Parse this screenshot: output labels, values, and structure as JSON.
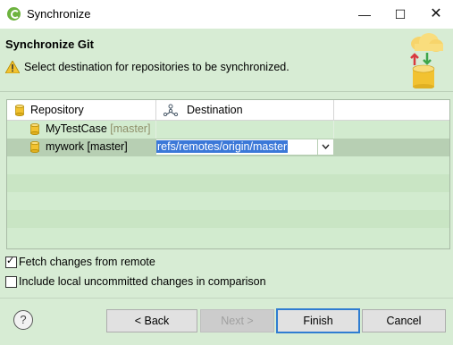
{
  "window": {
    "title": "Synchronize",
    "minimize": "—",
    "maximize": "☐",
    "close": "✕"
  },
  "header": {
    "title": "Synchronize Git",
    "message": "Select destination for repositories to be synchronized."
  },
  "table": {
    "columns": [
      "Repository",
      "Destination"
    ],
    "rows": [
      {
        "name": "MyTestCase",
        "branch": "[master]",
        "destination": ""
      },
      {
        "name": "mywork [master]",
        "branch": "",
        "destination": "refs/remotes/origin/master"
      }
    ]
  },
  "options": {
    "fetch": {
      "label": "Fetch changes from remote",
      "checked": true
    },
    "include_local": {
      "label": "Include local uncommitted changes in comparison",
      "checked": false
    }
  },
  "buttons": {
    "help": "?",
    "back": "< Back",
    "next": "Next >",
    "finish": "Finish",
    "cancel": "Cancel"
  },
  "colors": {
    "accent": "#2f7dd1",
    "selection": "#3b78d8",
    "background": "#d7ecd4"
  }
}
